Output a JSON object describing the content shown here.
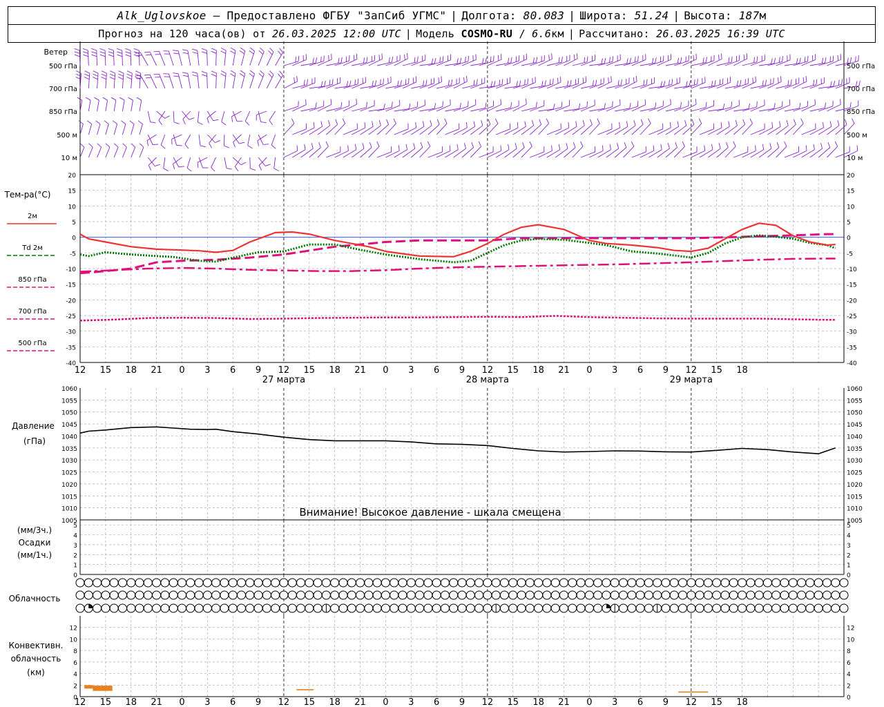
{
  "header": {
    "station": "Alk_Uglovskoe",
    "provider": "— Предоставлено ФГБУ \"ЗапСиб УГМС\"",
    "lon_label": "Долгота:",
    "lon": "80.083",
    "lat_label": "Широта:",
    "lat": "51.24",
    "alt_label": "Высота:",
    "alt": "187",
    "alt_unit": "м",
    "forecast_label": "Прогноз на 120 часа(ов) от",
    "forecast_start": "26.03.2025 12:00 UTC",
    "model_label": "Модель",
    "model": "COSMO-RU",
    "resolution": "6.6",
    "resolution_unit": "км",
    "calc_label": "Рассчитано:",
    "calc_time": "26.03.2025 16:39 UTC"
  },
  "labels": {
    "wind": "Ветер",
    "wind_levels": [
      "500 гПа",
      "700 гПа",
      "850 гПа",
      "500 м",
      "10 м"
    ],
    "temp_title": "Тем-ра(°C)",
    "temp_legend": [
      {
        "label": "2м",
        "color": "#ee3333",
        "style": "solid"
      },
      {
        "label": "Td  2м",
        "color": "#007700",
        "style": "dotted"
      },
      {
        "label": "850 гПа",
        "color": "#e0107a",
        "style": "dashed"
      },
      {
        "label": "700 гПа",
        "color": "#e0107a",
        "style": "dashdot"
      },
      {
        "label": "500 гПа",
        "color": "#e0107a",
        "style": "finedash"
      }
    ],
    "pressure_title": "Давление",
    "pressure_unit": "(гПа)",
    "pressure_warning": "Внимание! Высокое давление - шкала смещена",
    "precip_unit_top": "(мм/3ч.)",
    "precip_title": "Осадки",
    "precip_unit_bottom": "(мм/1ч.)",
    "cloud_title": "Облачность",
    "conv_title_1": "Конвективн.",
    "conv_title_2": "облачность",
    "conv_unit": "(км)"
  },
  "axis": {
    "hour_ticks": [
      "12",
      "15",
      "18",
      "21",
      "0",
      "3",
      "6",
      "9",
      "12",
      "15",
      "18",
      "21",
      "0",
      "3",
      "6",
      "9",
      "12",
      "15",
      "18",
      "21",
      "0",
      "3",
      "6",
      "9",
      "12",
      "15",
      "18"
    ],
    "day_labels": [
      {
        "label": "27 марта",
        "hour": 24
      },
      {
        "label": "28 марта",
        "hour": 48
      },
      {
        "label": "29 марта",
        "hour": 72
      }
    ]
  },
  "chart_data": [
    {
      "type": "line",
      "title": "Тем-ра(°C)",
      "x_unit": "hours since 26.03.2025 12:00 UTC",
      "ylim": [
        -40,
        20
      ],
      "yticks": [
        20,
        15,
        10,
        5,
        0,
        -5,
        -10,
        -15,
        -20,
        -25,
        -30,
        -35,
        -40
      ],
      "series": [
        {
          "name": "2м",
          "x": [
            0,
            1,
            3,
            6,
            9,
            11,
            14,
            16,
            18,
            20,
            23,
            25,
            27,
            30,
            33,
            34,
            36,
            40,
            44,
            46,
            48,
            50,
            52,
            54,
            57,
            60,
            62,
            65,
            68,
            70,
            72,
            74,
            76,
            78,
            80,
            82,
            84,
            86,
            88,
            89
          ],
          "values": [
            1,
            -0.5,
            -1.5,
            -3,
            -3.8,
            -4,
            -4.3,
            -4.8,
            -4.2,
            -1.5,
            1.5,
            1.7,
            1,
            -1,
            -2.5,
            -3,
            -4.5,
            -6,
            -6.2,
            -4.5,
            -2,
            1,
            3.2,
            4,
            2.5,
            -1,
            -2,
            -2.5,
            -3.3,
            -4.2,
            -4.5,
            -3.5,
            -0.5,
            2.5,
            4.5,
            3.8,
            0.5,
            -1.5,
            -2.5,
            -2.3
          ]
        },
        {
          "name": "Td  2м",
          "x": [
            0,
            1,
            3,
            6,
            9,
            11,
            14,
            16,
            18,
            21,
            24,
            27,
            30,
            33,
            36,
            40,
            44,
            46,
            48,
            50,
            52,
            54,
            57,
            60,
            62,
            65,
            68,
            70,
            72,
            74,
            76,
            78,
            80,
            82,
            84,
            86,
            88,
            89
          ],
          "values": [
            -5.5,
            -6,
            -4.8,
            -5.5,
            -6,
            -6.3,
            -7.5,
            -7.8,
            -6.5,
            -4.8,
            -4.5,
            -2.3,
            -2.3,
            -4,
            -5.5,
            -7,
            -8,
            -7.5,
            -5,
            -2.5,
            -1,
            -0.5,
            -0.8,
            -1.8,
            -2.5,
            -4.5,
            -5.2,
            -5.8,
            -6.5,
            -5,
            -2,
            0,
            0.6,
            0.2,
            -0.5,
            -1.8,
            -2.5,
            -3.5
          ]
        },
        {
          "name": "850 гПа",
          "x": [
            0,
            3,
            6,
            9,
            12,
            16,
            20,
            24,
            30,
            33,
            36,
            40,
            44,
            48,
            52,
            56,
            60,
            64,
            68,
            72,
            76,
            80,
            84,
            88,
            89
          ],
          "values": [
            -11.5,
            -10.8,
            -10,
            -8,
            -7.5,
            -7.2,
            -6.5,
            -5.5,
            -3,
            -2.3,
            -1.5,
            -1,
            -1,
            -1,
            -0.3,
            -0.3,
            -0.3,
            -0.3,
            -0.3,
            -0.3,
            0,
            0.3,
            0.6,
            1,
            1
          ]
        },
        {
          "name": "700 гПа",
          "x": [
            0,
            4,
            8,
            12,
            16,
            20,
            24,
            28,
            32,
            36,
            40,
            44,
            48,
            52,
            56,
            60,
            64,
            68,
            72,
            76,
            80,
            84,
            88,
            89
          ],
          "values": [
            -11,
            -10.5,
            -10,
            -9.8,
            -10,
            -10.4,
            -10.6,
            -10.8,
            -10.8,
            -10.5,
            -10,
            -9.6,
            -9.4,
            -9.2,
            -9,
            -8.8,
            -8.6,
            -8.3,
            -8,
            -7.6,
            -7.2,
            -6.9,
            -6.8,
            -6.8
          ]
        },
        {
          "name": "500 гПа",
          "x": [
            0,
            4,
            8,
            12,
            16,
            20,
            24,
            28,
            32,
            36,
            40,
            44,
            48,
            52,
            56,
            60,
            64,
            68,
            72,
            76,
            80,
            84,
            88,
            89
          ],
          "values": [
            -26.6,
            -26.3,
            -25.8,
            -25.7,
            -25.8,
            -26.1,
            -26,
            -25.8,
            -25.7,
            -25.6,
            -25.6,
            -25.5,
            -25.4,
            -25.5,
            -25.1,
            -25.5,
            -25.7,
            -25.9,
            -26,
            -26,
            -26,
            -26.2,
            -26.4,
            -26.4
          ]
        }
      ]
    },
    {
      "type": "line",
      "title": "Давление",
      "ylabel": "(гПа)",
      "ylim": [
        1005,
        1060
      ],
      "yticks": [
        1060,
        1055,
        1050,
        1045,
        1040,
        1035,
        1030,
        1025,
        1020,
        1015,
        1010,
        1005
      ],
      "series": [
        {
          "name": "Давление",
          "x": [
            0,
            1,
            3,
            6,
            9,
            11,
            13,
            15,
            16,
            18,
            21,
            24,
            27,
            30,
            33,
            36,
            39,
            42,
            45,
            48,
            51,
            54,
            57,
            60,
            63,
            66,
            69,
            72,
            75,
            78,
            81,
            84,
            87,
            89
          ],
          "values": [
            1041.2,
            1042,
            1042.5,
            1043.5,
            1043.8,
            1043.3,
            1042.8,
            1042.7,
            1042.8,
            1041.8,
            1040.8,
            1039.5,
            1038.5,
            1038,
            1038,
            1038,
            1037.5,
            1036.7,
            1036.5,
            1036,
            1034.8,
            1033.8,
            1033.3,
            1033.5,
            1033.8,
            1033.7,
            1033.4,
            1033.3,
            1034,
            1034.8,
            1034.3,
            1033.3,
            1032.6,
            1035
          ]
        }
      ]
    },
    {
      "type": "bar",
      "title": "Осадки",
      "ylim": [
        0,
        5.5
      ],
      "yticks": [
        5,
        4,
        3,
        2,
        1,
        0
      ],
      "values": []
    },
    {
      "type": "bar",
      "title": "Конвективн. облачность",
      "ylabel": "(км)",
      "ylim": [
        0,
        14
      ],
      "yticks": [
        12,
        10,
        8,
        6,
        4,
        2,
        0
      ],
      "segments": [
        {
          "x0": 0.5,
          "x1": 1.5,
          "base": 1.4,
          "top": 2.0
        },
        {
          "x0": 1.5,
          "x1": 3.8,
          "base": 1.0,
          "top": 1.9
        },
        {
          "x0": 25.5,
          "x1": 27.5,
          "base": 1.1,
          "top": 1.3
        },
        {
          "x0": 70.5,
          "x1": 74.0,
          "base": 0.7,
          "top": 0.9
        }
      ]
    }
  ],
  "wind_style": {
    "color": "#8822cc"
  },
  "cloud_partial": [
    {
      "row": 2,
      "index": 1,
      "type": "quarter"
    },
    {
      "row": 2,
      "index": 29,
      "type": "half-line"
    },
    {
      "row": 2,
      "index": 49,
      "type": "half-line"
    },
    {
      "row": 2,
      "index": 62,
      "type": "quarter"
    },
    {
      "row": 2,
      "index": 63,
      "type": "half-line"
    },
    {
      "row": 2,
      "index": 68,
      "type": "half-line"
    }
  ]
}
